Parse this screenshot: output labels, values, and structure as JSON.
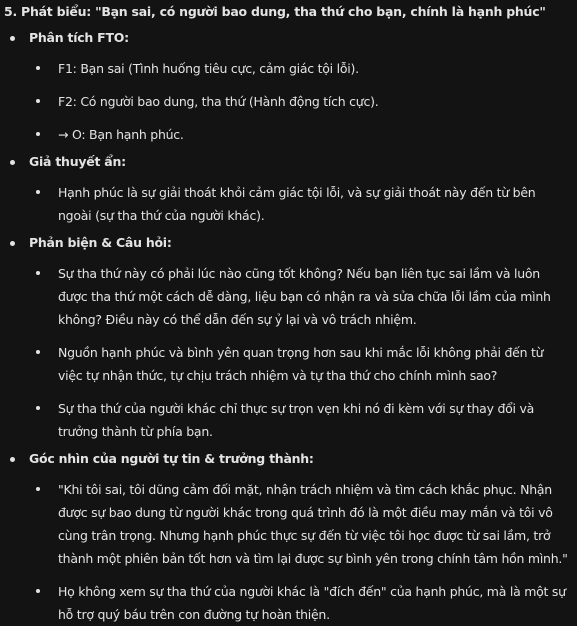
{
  "heading": "5. Phát biểu: \"Bạn sai, có người bao dung, tha thứ cho bạn, chính là hạnh phúc\"",
  "sections": [
    {
      "title": "Phân tích FTO:",
      "items": [
        "F1: Bạn sai (Tình huống tiêu cực, cảm giác tội lỗi).",
        "F2: Có người bao dung, tha thứ (Hành động tích cực).",
        "→ O: Bạn hạnh phúc."
      ]
    },
    {
      "title": "Giả thuyết ẩn:",
      "items": [
        "Hạnh phúc là sự giải thoát khỏi cảm giác tội lỗi, và sự giải thoát này đến từ bên ngoài (sự tha thứ của người khác)."
      ]
    },
    {
      "title": "Phản biện & Câu hỏi:",
      "items": [
        "Sự tha thứ này có phải lúc nào cũng tốt không? Nếu bạn liên tục sai lầm và luôn được tha thứ một cách dễ dàng, liệu bạn có nhận ra và sửa chữa lỗi lầm của mình không? Điều này có thể dẫn đến sự ỷ lại và vô trách nhiệm.",
        "Nguồn hạnh phúc và bình yên quan trọng hơn sau khi mắc lỗi không phải đến từ việc tự nhận thức, tự chịu trách nhiệm và tự tha thứ cho chính mình sao?",
        "Sự tha thứ của người khác chỉ thực sự trọn vẹn khi nó đi kèm với sự thay đổi và trưởng thành từ phía bạn."
      ]
    },
    {
      "title": "Góc nhìn của người tự tin & trưởng thành:",
      "items": [
        "\"Khi tôi sai, tôi dũng cảm đối mặt, nhận trách nhiệm và tìm cách khắc phục. Nhận được sự bao dung từ người khác trong quá trình đó là một điều may mắn và tôi vô cùng trân trọng. Nhưng hạnh phúc thực sự đến từ việc tôi học được từ sai lầm, trở thành một phiên bản tốt hơn và tìm lại được sự bình yên trong chính tâm hồn mình.\"",
        "Họ không xem sự tha thứ của người khác là \"đích đến\" của hạnh phúc, mà là một sự hỗ trợ quý báu trên con đường tự hoàn thiện."
      ]
    }
  ]
}
